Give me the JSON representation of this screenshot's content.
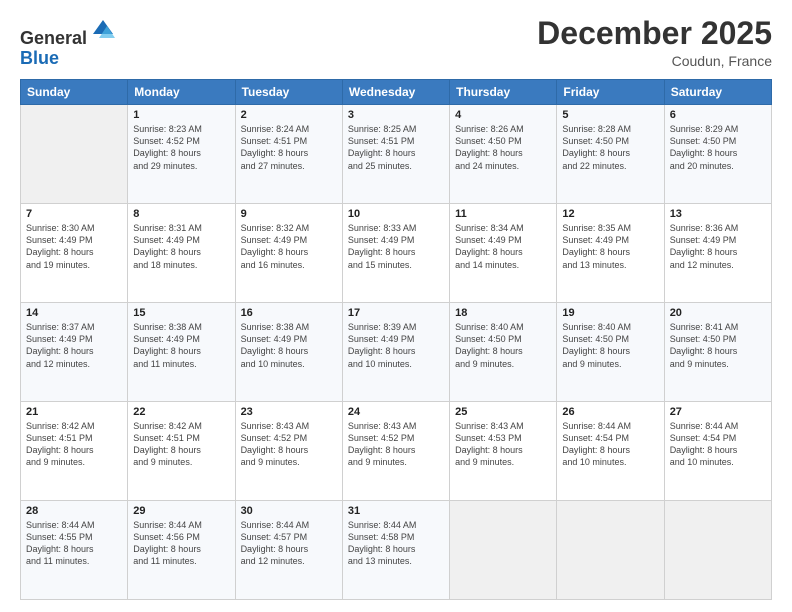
{
  "header": {
    "logo_general": "General",
    "logo_blue": "Blue",
    "month_title": "December 2025",
    "location": "Coudun, France"
  },
  "days_of_week": [
    "Sunday",
    "Monday",
    "Tuesday",
    "Wednesday",
    "Thursday",
    "Friday",
    "Saturday"
  ],
  "weeks": [
    [
      {
        "day": "",
        "detail": ""
      },
      {
        "day": "1",
        "detail": "Sunrise: 8:23 AM\nSunset: 4:52 PM\nDaylight: 8 hours\nand 29 minutes."
      },
      {
        "day": "2",
        "detail": "Sunrise: 8:24 AM\nSunset: 4:51 PM\nDaylight: 8 hours\nand 27 minutes."
      },
      {
        "day": "3",
        "detail": "Sunrise: 8:25 AM\nSunset: 4:51 PM\nDaylight: 8 hours\nand 25 minutes."
      },
      {
        "day": "4",
        "detail": "Sunrise: 8:26 AM\nSunset: 4:50 PM\nDaylight: 8 hours\nand 24 minutes."
      },
      {
        "day": "5",
        "detail": "Sunrise: 8:28 AM\nSunset: 4:50 PM\nDaylight: 8 hours\nand 22 minutes."
      },
      {
        "day": "6",
        "detail": "Sunrise: 8:29 AM\nSunset: 4:50 PM\nDaylight: 8 hours\nand 20 minutes."
      }
    ],
    [
      {
        "day": "7",
        "detail": "Sunrise: 8:30 AM\nSunset: 4:49 PM\nDaylight: 8 hours\nand 19 minutes."
      },
      {
        "day": "8",
        "detail": "Sunrise: 8:31 AM\nSunset: 4:49 PM\nDaylight: 8 hours\nand 18 minutes."
      },
      {
        "day": "9",
        "detail": "Sunrise: 8:32 AM\nSunset: 4:49 PM\nDaylight: 8 hours\nand 16 minutes."
      },
      {
        "day": "10",
        "detail": "Sunrise: 8:33 AM\nSunset: 4:49 PM\nDaylight: 8 hours\nand 15 minutes."
      },
      {
        "day": "11",
        "detail": "Sunrise: 8:34 AM\nSunset: 4:49 PM\nDaylight: 8 hours\nand 14 minutes."
      },
      {
        "day": "12",
        "detail": "Sunrise: 8:35 AM\nSunset: 4:49 PM\nDaylight: 8 hours\nand 13 minutes."
      },
      {
        "day": "13",
        "detail": "Sunrise: 8:36 AM\nSunset: 4:49 PM\nDaylight: 8 hours\nand 12 minutes."
      }
    ],
    [
      {
        "day": "14",
        "detail": "Sunrise: 8:37 AM\nSunset: 4:49 PM\nDaylight: 8 hours\nand 12 minutes."
      },
      {
        "day": "15",
        "detail": "Sunrise: 8:38 AM\nSunset: 4:49 PM\nDaylight: 8 hours\nand 11 minutes."
      },
      {
        "day": "16",
        "detail": "Sunrise: 8:38 AM\nSunset: 4:49 PM\nDaylight: 8 hours\nand 10 minutes."
      },
      {
        "day": "17",
        "detail": "Sunrise: 8:39 AM\nSunset: 4:49 PM\nDaylight: 8 hours\nand 10 minutes."
      },
      {
        "day": "18",
        "detail": "Sunrise: 8:40 AM\nSunset: 4:50 PM\nDaylight: 8 hours\nand 9 minutes."
      },
      {
        "day": "19",
        "detail": "Sunrise: 8:40 AM\nSunset: 4:50 PM\nDaylight: 8 hours\nand 9 minutes."
      },
      {
        "day": "20",
        "detail": "Sunrise: 8:41 AM\nSunset: 4:50 PM\nDaylight: 8 hours\nand 9 minutes."
      }
    ],
    [
      {
        "day": "21",
        "detail": "Sunrise: 8:42 AM\nSunset: 4:51 PM\nDaylight: 8 hours\nand 9 minutes."
      },
      {
        "day": "22",
        "detail": "Sunrise: 8:42 AM\nSunset: 4:51 PM\nDaylight: 8 hours\nand 9 minutes."
      },
      {
        "day": "23",
        "detail": "Sunrise: 8:43 AM\nSunset: 4:52 PM\nDaylight: 8 hours\nand 9 minutes."
      },
      {
        "day": "24",
        "detail": "Sunrise: 8:43 AM\nSunset: 4:52 PM\nDaylight: 8 hours\nand 9 minutes."
      },
      {
        "day": "25",
        "detail": "Sunrise: 8:43 AM\nSunset: 4:53 PM\nDaylight: 8 hours\nand 9 minutes."
      },
      {
        "day": "26",
        "detail": "Sunrise: 8:44 AM\nSunset: 4:54 PM\nDaylight: 8 hours\nand 10 minutes."
      },
      {
        "day": "27",
        "detail": "Sunrise: 8:44 AM\nSunset: 4:54 PM\nDaylight: 8 hours\nand 10 minutes."
      }
    ],
    [
      {
        "day": "28",
        "detail": "Sunrise: 8:44 AM\nSunset: 4:55 PM\nDaylight: 8 hours\nand 11 minutes."
      },
      {
        "day": "29",
        "detail": "Sunrise: 8:44 AM\nSunset: 4:56 PM\nDaylight: 8 hours\nand 11 minutes."
      },
      {
        "day": "30",
        "detail": "Sunrise: 8:44 AM\nSunset: 4:57 PM\nDaylight: 8 hours\nand 12 minutes."
      },
      {
        "day": "31",
        "detail": "Sunrise: 8:44 AM\nSunset: 4:58 PM\nDaylight: 8 hours\nand 13 minutes."
      },
      {
        "day": "",
        "detail": ""
      },
      {
        "day": "",
        "detail": ""
      },
      {
        "day": "",
        "detail": ""
      }
    ]
  ]
}
